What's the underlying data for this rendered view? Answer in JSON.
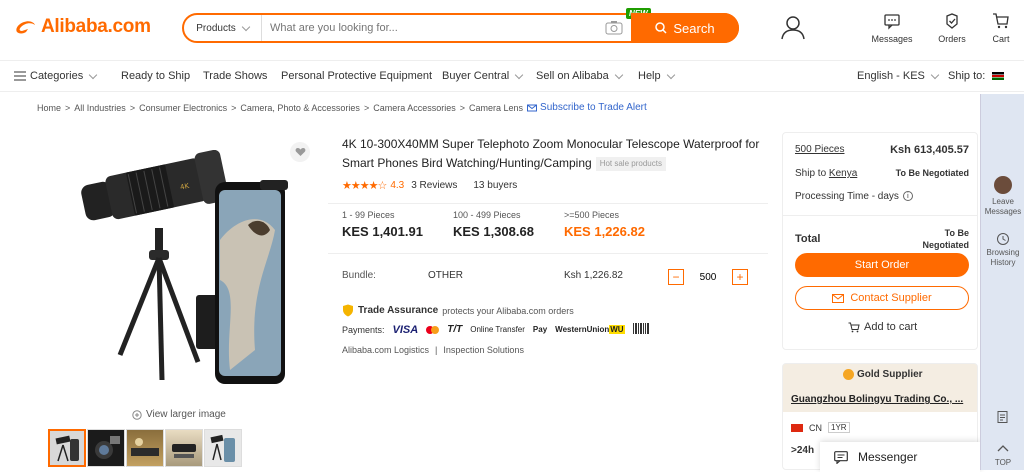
{
  "header": {
    "logo": "Alibaba.com",
    "search": {
      "category": "Products",
      "placeholder": "What are you looking for...",
      "button": "Search",
      "badge": "NEW"
    },
    "icons": [
      {
        "label": "Messages"
      },
      {
        "label": "Orders"
      },
      {
        "label": "Cart"
      }
    ]
  },
  "nav": {
    "items": [
      "Categories",
      "Ready to Ship",
      "Trade Shows",
      "Personal Protective Equipment",
      "Buyer Central",
      "Sell on Alibaba",
      "Help"
    ],
    "language": "English - KES",
    "ship_to": "Ship to:"
  },
  "breadcrumb": {
    "items": [
      "Home",
      "All Industries",
      "Consumer Electronics",
      "Camera, Photo & Accessories",
      "Camera Accessories",
      "Camera Lens"
    ],
    "subscribe": "Subscribe to Trade Alert"
  },
  "product": {
    "title": "4K 10-300X40MM Super Telephoto Zoom Monocular Telescope Waterproof for Smart Phones Bird Watching/Hunting/Camping",
    "tag": "Hot sale products",
    "rating": "4.3",
    "reviews": "3 Reviews",
    "buyers": "13 buyers",
    "view_larger": "View larger image",
    "tiers": [
      {
        "range": "1 - 99 Pieces",
        "price": "KES 1,401.91"
      },
      {
        "range": "100 - 499 Pieces",
        "price": "KES 1,308.68"
      },
      {
        "range": ">=500 Pieces",
        "price": "KES 1,226.82"
      }
    ],
    "bundle_label": "Bundle:",
    "bundle_value": "OTHER",
    "bundle_price": "Ksh 1,226.82",
    "quantity": "500",
    "trade_assurance": "Trade Assurance",
    "trade_text": "protects your Alibaba.com orders",
    "payments_label": "Payments:",
    "payments": [
      "VISA",
      "T/T",
      "Online Transfer",
      "Pay",
      "WesternUnion",
      "WU"
    ],
    "logistics": [
      "Alibaba.com Logistics",
      "Inspection Solutions"
    ]
  },
  "order": {
    "qty": "500 Pieces",
    "price": "Ksh 613,405.57",
    "ship_label": "Ship to",
    "ship_country": "Kenya",
    "ship_status": "To Be Negotiated",
    "processing": "Processing Time - days",
    "total_label": "Total",
    "total_value": "To Be Negotiated",
    "start_order": "Start Order",
    "contact": "Contact Supplier",
    "add_cart": "Add to cart"
  },
  "supplier": {
    "badge": "Gold Supplier",
    "name": "Guangzhou Bolingyu Trading Co., ...",
    "country": "CN",
    "years": "1YR",
    "response": ">24h"
  },
  "messenger": "Messenger",
  "rail": {
    "leave": "Leave Messages",
    "history": "Browsing History",
    "top": "TOP"
  },
  "colors": {
    "accent": "#ff6a00",
    "link": "#3366cc"
  }
}
